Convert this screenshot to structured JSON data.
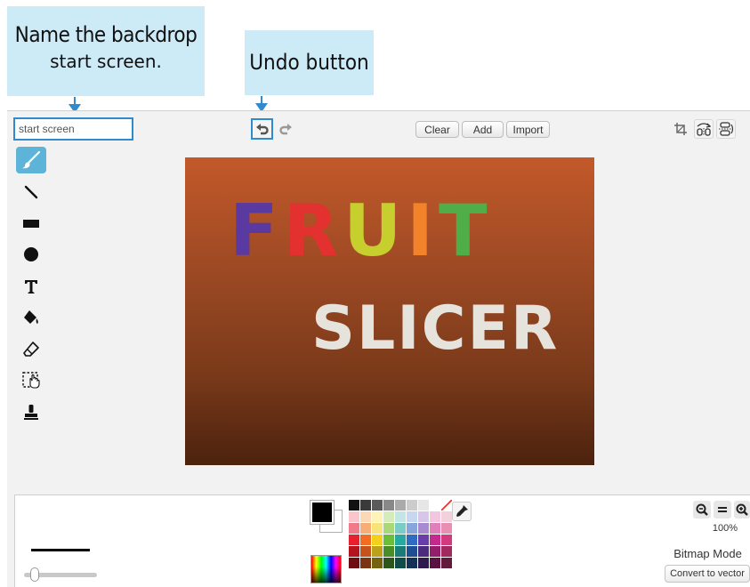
{
  "callouts": {
    "name_backdrop_line1": "Name the backdrop",
    "name_backdrop_line2": "start screen.",
    "undo_button": "Undo button"
  },
  "editor": {
    "costume_name": "start screen",
    "toolbar": {
      "clear_label": "Clear",
      "add_label": "Add",
      "import_label": "Import"
    },
    "tools": [
      "brush-tool",
      "line-tool",
      "rectangle-tool",
      "ellipse-tool",
      "text-tool",
      "fill-tool",
      "eraser-tool",
      "select-tool",
      "stamp-tool"
    ],
    "canvas": {
      "title_word1": "FRUIT",
      "title_word2": "SLICER",
      "fruit_letter_colors": [
        "#5a3aa0",
        "#e2312e",
        "#c6cf2e",
        "#f2832a",
        "#4fae47"
      ],
      "slicer_color": "#e6e3dc",
      "background_top": "#c2592a",
      "background_bottom": "#4c220e"
    },
    "zoom_level": "100%",
    "mode_label": "Bitmap Mode",
    "convert_label": "Convert to vector",
    "primary_color": "#000000",
    "secondary_color": "#ffffff",
    "palette": [
      [
        "#111111",
        "#3a3a3a",
        "#5a5a5a",
        "#888888",
        "#aaaaaa",
        "#cccccc",
        "#e6e6e6",
        "#ffffff",
        "none"
      ],
      [
        "#f8c6cb",
        "#fbd8b8",
        "#fdf3b6",
        "#d6ecb8",
        "#c3e6e4",
        "#c6d7ef",
        "#d7c6ea",
        "#f3c6e0",
        "#f4d0dd"
      ],
      [
        "#f07a8a",
        "#f7ad76",
        "#f8e37a",
        "#a9d77a",
        "#79cdc6",
        "#86a6dc",
        "#a88ad0",
        "#e07fb9",
        "#e890b4"
      ],
      [
        "#e8202e",
        "#f26d22",
        "#f3d01a",
        "#6cbd3a",
        "#25a9a1",
        "#2f6bc1",
        "#6a3ea8",
        "#c42a8d",
        "#d13a7e"
      ],
      [
        "#b3141e",
        "#c4541b",
        "#bba21a",
        "#4b8c29",
        "#1a7c76",
        "#1f4f92",
        "#4c2b7e",
        "#931f6a",
        "#a02a5e"
      ],
      [
        "#6e0c12",
        "#7a3411",
        "#746412",
        "#2e561a",
        "#104c48",
        "#143158",
        "#2f1a4d",
        "#5a1341",
        "#611a3a"
      ]
    ]
  }
}
